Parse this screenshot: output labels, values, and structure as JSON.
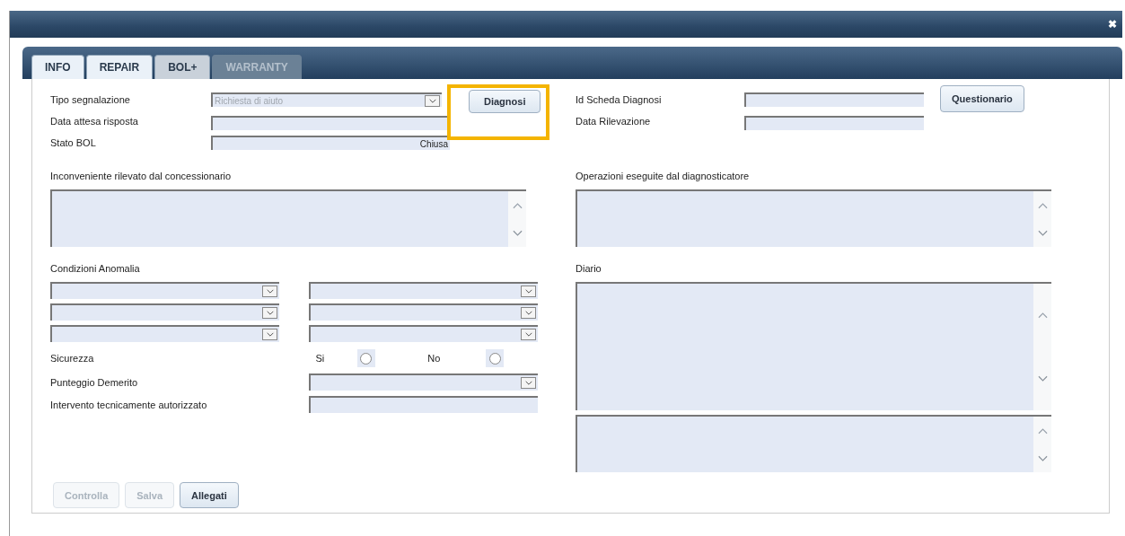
{
  "window": {
    "close_label": "✖"
  },
  "tabs": [
    {
      "label": "INFO",
      "selected": false,
      "disabled": false
    },
    {
      "label": "REPAIR",
      "selected": false,
      "disabled": false
    },
    {
      "label": "BOL+",
      "selected": true,
      "disabled": false
    },
    {
      "label": "WARRANTY",
      "selected": false,
      "disabled": true
    }
  ],
  "top_left_fields": [
    {
      "label": "Tipo segnalazione",
      "kind": "dropdown",
      "value": "Richiesta di aiuto",
      "disabled": true
    },
    {
      "label": "Data attesa risposta",
      "kind": "text"
    },
    {
      "label": "Stato BOL",
      "kind": "text",
      "value": "Chiusa"
    }
  ],
  "diagnosi_button": {
    "label": "Diagnosi",
    "highlighted": true
  },
  "top_right_fields": [
    {
      "label": "Id Scheda Diagnosi",
      "kind": "text"
    },
    {
      "label": "Data Rilevazione",
      "kind": "text"
    }
  ],
  "questionario_button": {
    "label": "Questionario"
  },
  "inconveniente": {
    "label": "Inconveniente rilevato dal concessionario"
  },
  "operazioni": {
    "label": "Operazioni eseguite dal diagnosticatore"
  },
  "condizioni": {
    "label": "Condizioni Anomalia",
    "dropdowns": [
      {
        "kind": "dropdown"
      },
      {
        "kind": "dropdown"
      },
      {
        "kind": "dropdown"
      },
      {
        "kind": "dropdown"
      },
      {
        "kind": "dropdown"
      },
      {
        "kind": "dropdown"
      }
    ]
  },
  "sicurezza": {
    "label": "Sicurezza",
    "options": [
      {
        "label": "Si",
        "selected": false
      },
      {
        "label": "No",
        "selected": false
      }
    ]
  },
  "lower_fields": [
    {
      "label": "Punteggio Demerito",
      "kind": "dropdown"
    },
    {
      "label": "Intervento tecnicamente autorizzato",
      "kind": "text"
    }
  ],
  "diario": {
    "label": "Diario"
  },
  "buttons": [
    {
      "label": "Controlla",
      "disabled": true
    },
    {
      "label": "Salva",
      "disabled": true
    },
    {
      "label": "Allegati",
      "disabled": false
    }
  ]
}
